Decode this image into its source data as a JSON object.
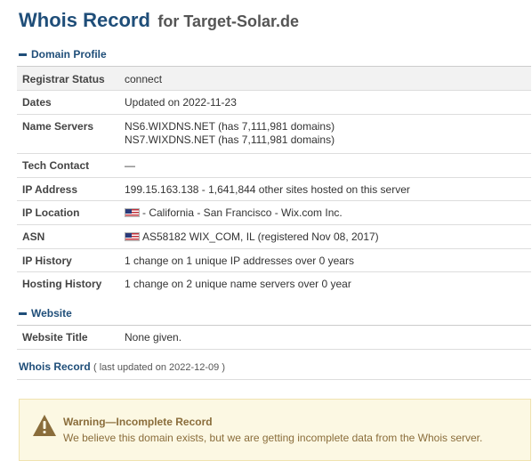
{
  "header": {
    "title": "Whois Record",
    "domain_suffix": "for Target-Solar.de"
  },
  "domain_profile": {
    "section_label": "Domain Profile",
    "rows": [
      {
        "key": "Registrar Status",
        "values": [
          "connect"
        ]
      },
      {
        "key": "Dates",
        "values": [
          "Updated on 2022-11-23"
        ]
      },
      {
        "key": "Name Servers",
        "values": [
          "NS6.WIXDNS.NET (has 7,111,981 domains)",
          "NS7.WIXDNS.NET (has 7,111,981 domains)"
        ]
      },
      {
        "key": "Tech Contact",
        "values": [
          "—"
        ]
      },
      {
        "key": "IP Address",
        "values": [
          "199.15.163.138 - 1,641,844 other sites hosted on this server"
        ]
      },
      {
        "key": "IP Location",
        "values": [
          "- California - San Francisco - Wix.com Inc."
        ],
        "flag": "us-flag-icon"
      },
      {
        "key": "ASN",
        "values": [
          "AS58182 WIX_COM, IL (registered Nov 08, 2017)"
        ],
        "flag": "us-flag-icon"
      },
      {
        "key": "IP History",
        "values": [
          "1 change on 1 unique IP addresses over 0 years"
        ]
      },
      {
        "key": "Hosting History",
        "values": [
          "1 change on 2 unique name servers over 0 year"
        ]
      }
    ]
  },
  "website": {
    "section_label": "Website",
    "rows": [
      {
        "key": "Website Title",
        "values": [
          "None given."
        ]
      }
    ]
  },
  "footer": {
    "link_label": "Whois Record",
    "last_updated": "( last updated on 2022-12-09 )"
  },
  "warning": {
    "icon": "warning-triangle-icon",
    "title": "Warning—Incomplete Record",
    "text": "We believe this domain exists, but we are getting incomplete data from the Whois server."
  },
  "colors": {
    "heading": "#1f4e79",
    "warning_bg": "#fcf8e3",
    "warning_text": "#8a6d3b"
  }
}
